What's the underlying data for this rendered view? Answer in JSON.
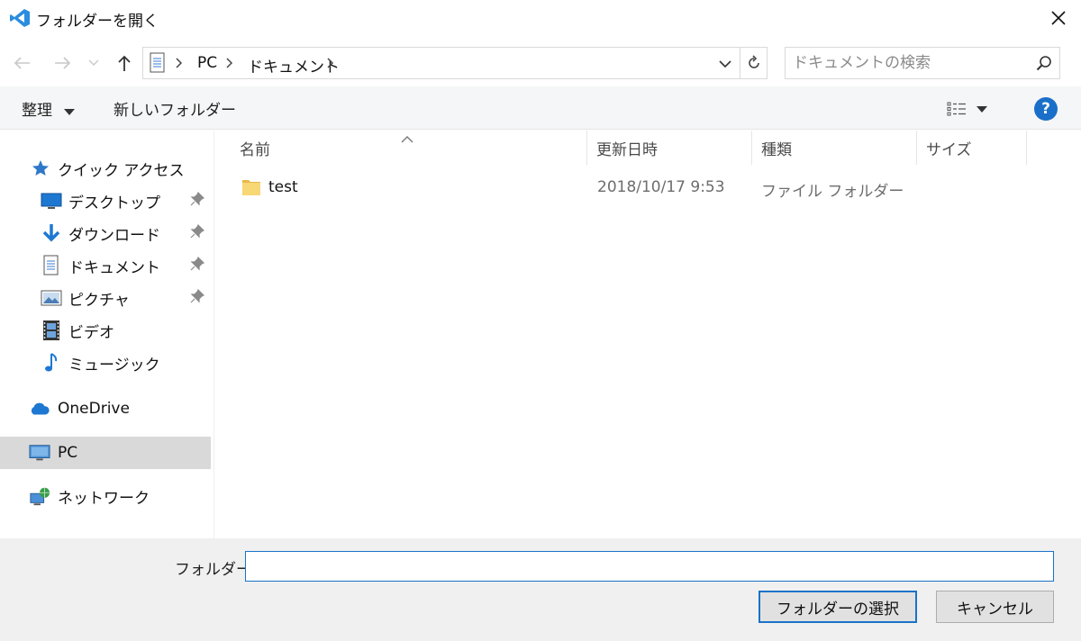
{
  "window": {
    "title": "フォルダーを開く"
  },
  "address": {
    "crumbs": [
      "PC",
      "ドキュメント"
    ]
  },
  "search": {
    "placeholder": "ドキュメントの検索"
  },
  "toolbar": {
    "organize_label": "整理",
    "new_folder_label": "新しいフォルダー"
  },
  "help": {
    "label": "?"
  },
  "sidebar": {
    "quick_access": "クイック アクセス",
    "items": [
      {
        "label": "デスクトップ",
        "icon": "desktop-icon",
        "pinned": true
      },
      {
        "label": "ダウンロード",
        "icon": "download-icon",
        "pinned": true
      },
      {
        "label": "ドキュメント",
        "icon": "document-icon",
        "pinned": true
      },
      {
        "label": "ピクチャ",
        "icon": "picture-icon",
        "pinned": true
      },
      {
        "label": "ビデオ",
        "icon": "video-icon",
        "pinned": false
      },
      {
        "label": "ミュージック",
        "icon": "music-icon",
        "pinned": false
      }
    ],
    "onedrive": "OneDrive",
    "pc": "PC",
    "network": "ネットワーク"
  },
  "columns": {
    "name": "名前",
    "date": "更新日時",
    "type": "種類",
    "size": "サイズ"
  },
  "files": [
    {
      "name": "test",
      "date": "2018/10/17 9:53",
      "type": "ファイル フォルダー"
    }
  ],
  "footer": {
    "folder_label": "フォルダー:",
    "folder_value": "",
    "select_button": "フォルダーの選択",
    "cancel_button": "キャンセル"
  },
  "colors": {
    "accent": "#1a73c9",
    "vscode_blue": "#2b8ce0",
    "folder_yellow": "#f8d775"
  }
}
